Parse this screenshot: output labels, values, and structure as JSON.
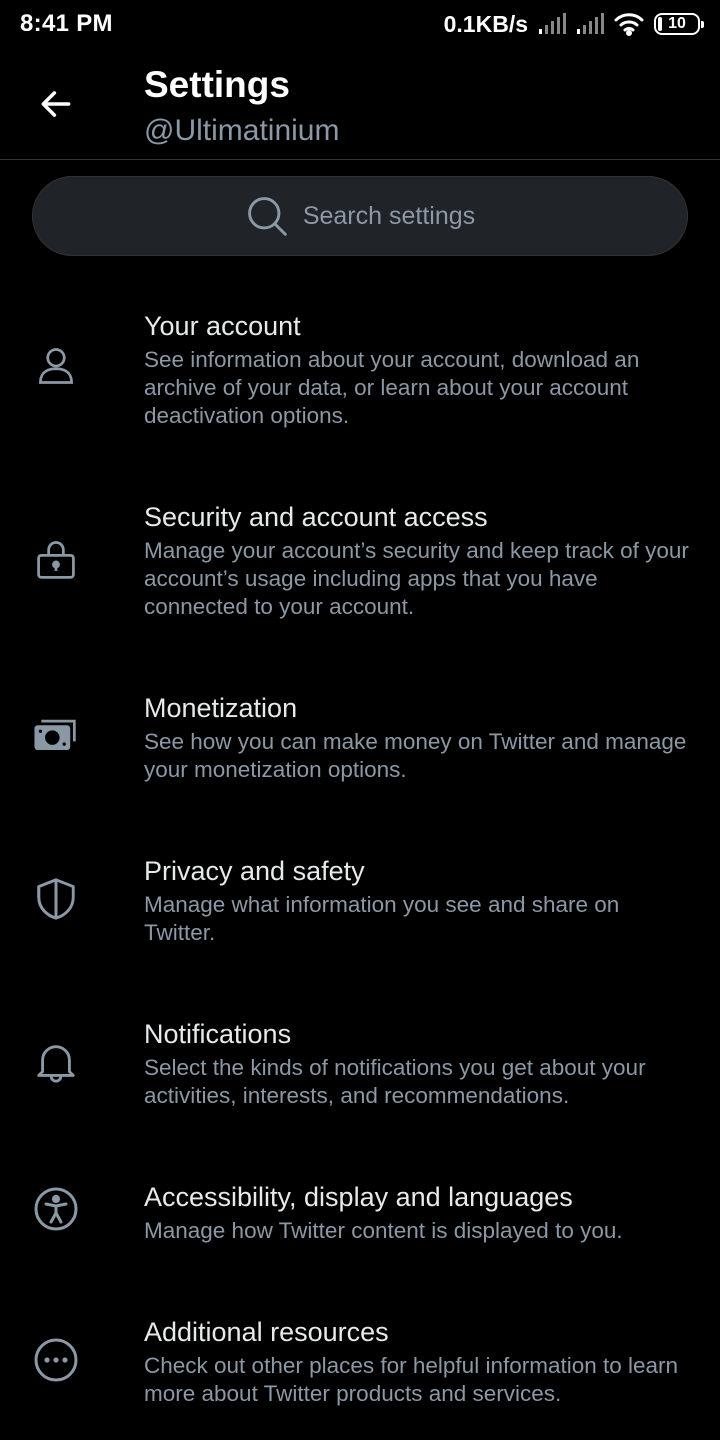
{
  "status_bar": {
    "time": "8:41 PM",
    "network_speed": "0.1KB/s",
    "battery_level": "10",
    "battery_fraction": 0.1
  },
  "header": {
    "title": "Settings",
    "subtitle": "@Ultimatinium",
    "back_icon": "arrow-left-icon"
  },
  "search": {
    "placeholder": "Search settings",
    "icon": "search-icon"
  },
  "settings": [
    {
      "title": "Your account",
      "description": "See information about your account, download an archive of your data, or learn about your account deactivation options.",
      "icon": "person-icon"
    },
    {
      "title": "Security and account access",
      "description": "Manage your account’s security and keep track of your account’s usage including apps that you have connected to your account.",
      "icon": "lock-icon"
    },
    {
      "title": "Monetization",
      "description": "See how you can make money on Twitter and manage your monetization options.",
      "icon": "money-icon"
    },
    {
      "title": "Privacy and safety",
      "description": "Manage what information you see and share on Twitter.",
      "icon": "shield-icon"
    },
    {
      "title": "Notifications",
      "description": "Select the kinds of notifications you get about your activities, interests, and recommendations.",
      "icon": "bell-icon"
    },
    {
      "title": "Accessibility, display and languages",
      "description": "Manage how Twitter content is displayed to you.",
      "icon": "accessibility-icon"
    },
    {
      "title": "Additional resources",
      "description": "Check out other places for helpful information to learn more about Twitter products and services.",
      "icon": "more-icon"
    }
  ],
  "colors": {
    "background": "#000000",
    "primary_text": "#e7e9ea",
    "secondary_text": "#8b98a5",
    "search_background": "#202327"
  }
}
